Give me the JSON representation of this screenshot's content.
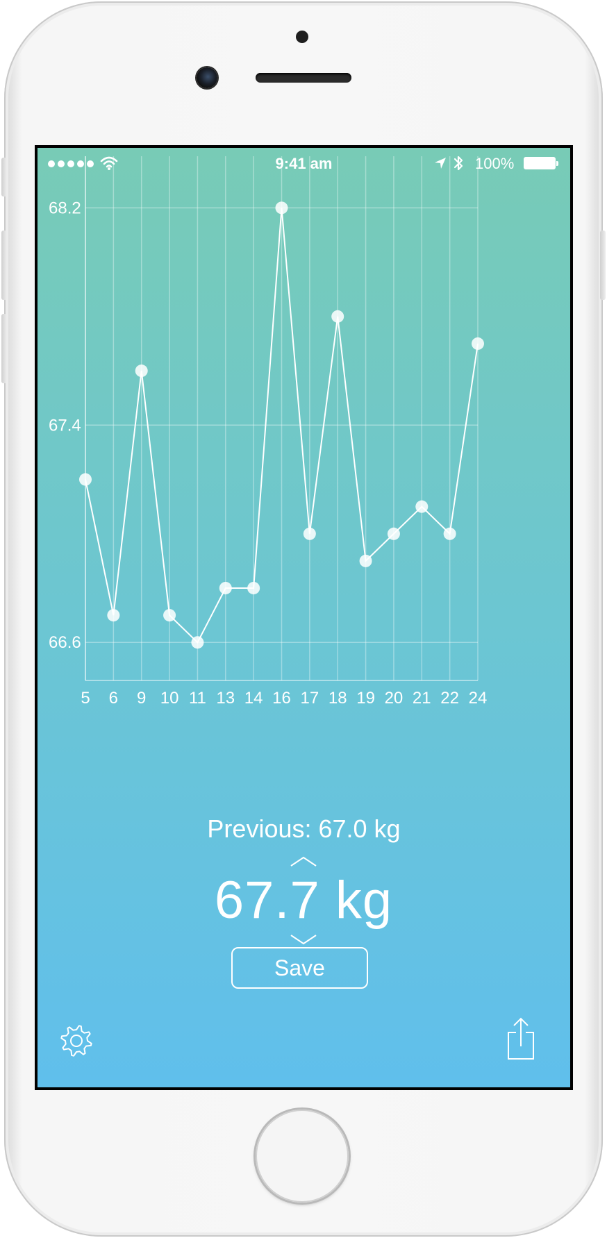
{
  "status_bar": {
    "time": "9:41 am",
    "battery": "100%"
  },
  "colors": {
    "gradient_top": "#78cbb6",
    "gradient_bottom": "#60bfec",
    "foreground": "#ffffff"
  },
  "chart_data": {
    "type": "line",
    "categories": [
      "5",
      "6",
      "9",
      "10",
      "11",
      "13",
      "14",
      "16",
      "17",
      "18",
      "19",
      "20",
      "21",
      "22",
      "24"
    ],
    "series": [
      {
        "values": [
          67.2,
          66.7,
          67.6,
          66.7,
          66.6,
          66.8,
          66.8,
          68.2,
          67.0,
          67.8,
          66.9,
          67.0,
          67.1,
          67.0,
          67.7
        ]
      }
    ],
    "y_ticks": [
      "66.6",
      "67.4",
      "68.2"
    ],
    "ylim": [
      66.46,
      68.39
    ],
    "grid": true,
    "markers": true
  },
  "previous_label": "Previous: 67.0 kg",
  "current_weight": "67.7 kg",
  "save_label": "Save",
  "icons": {
    "settings": "gear-icon",
    "share": "share-icon",
    "increment": "chevron-up-icon",
    "decrement": "chevron-down-icon"
  }
}
